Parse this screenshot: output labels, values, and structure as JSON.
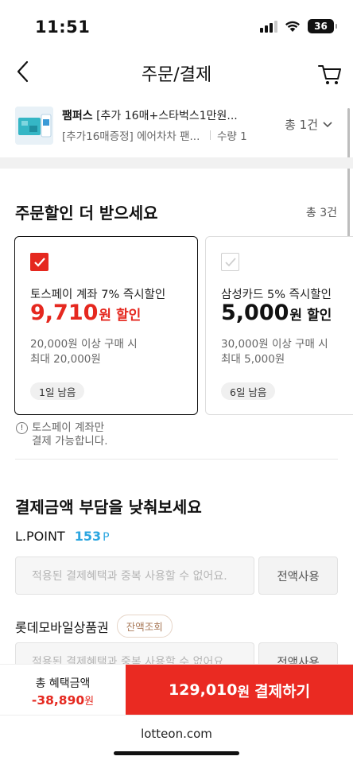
{
  "status": {
    "time": "11:51",
    "battery": "36"
  },
  "header": {
    "title": "주문/결제"
  },
  "product": {
    "brand": "팸퍼스",
    "name": " [추가 16매+스타벅스1만원...",
    "option": "[추가16매증정] 에어차차 팬...",
    "qty": "수량 1",
    "total": "총 1건"
  },
  "discount": {
    "title": "주문할인 더 받으세요",
    "count": "총 3건",
    "cards": [
      {
        "desc": "토스페이 계좌 7% 즉시할인",
        "amount": "9,710",
        "unit": "원 할인",
        "cond1": "20,000원 이상 구매 시",
        "cond2": "최대 20,000원",
        "days": "1일 남음",
        "selected": true
      },
      {
        "desc": "삼성카드 5% 즉시할인",
        "amount": "5,000",
        "unit": "원 할인",
        "cond1": "30,000원 이상 구매 시",
        "cond2": "최대 5,000원",
        "days": "6일 남음",
        "selected": false
      }
    ],
    "note_line1": "토스페이 계좌만",
    "note_line2": "결제 가능합니다."
  },
  "payment": {
    "title": "결제금액 부담을 낮춰보세요",
    "lpoint_label": "L.POINT",
    "lpoint_value": "153",
    "lpoint_unit": "P",
    "input_placeholder": "적용된 결제혜택과 중복 사용할 수 없어요.",
    "use_all_label": "전액사용",
    "gift_label": "롯데모바일상품권",
    "gift_check_label": "잔액조회"
  },
  "bottom": {
    "benefit_label": "총 혜택금액",
    "benefit_value": "-38,890",
    "benefit_unit": "원",
    "pay_amount": "129,010",
    "pay_unit": "원",
    "pay_label": "결제하기"
  },
  "browser": {
    "url": "lotteon.com"
  },
  "colors": {
    "accent": "#ea2a22",
    "point": "#2ba6e0"
  }
}
